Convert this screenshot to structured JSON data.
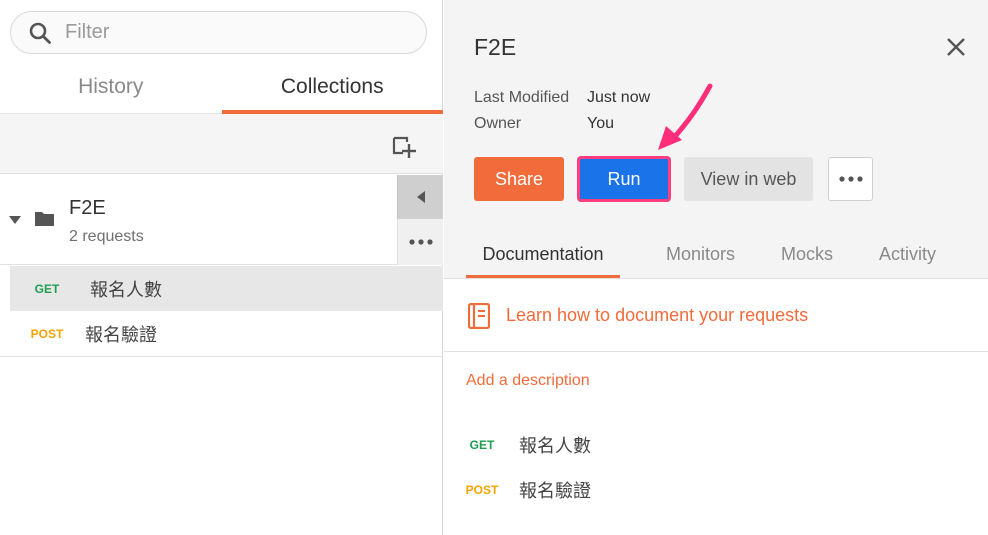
{
  "search": {
    "placeholder": "Filter"
  },
  "sidebar": {
    "tabs": [
      {
        "label": "History",
        "active": false
      },
      {
        "label": "Collections",
        "active": true
      }
    ],
    "collection": {
      "name": "F2E",
      "count": "2 requests",
      "requests": [
        {
          "method": "GET",
          "name": "報名人數"
        },
        {
          "method": "POST",
          "name": "報名驗證"
        }
      ]
    }
  },
  "panel": {
    "title": "F2E",
    "meta": [
      {
        "label": "Last Modified",
        "value": "Just now"
      },
      {
        "label": "Owner",
        "value": "You"
      }
    ],
    "buttons": {
      "share": "Share",
      "run": "Run",
      "view_web": "View in web"
    },
    "tabs": [
      {
        "label": "Documentation",
        "active": true
      },
      {
        "label": "Monitors",
        "active": false
      },
      {
        "label": "Mocks",
        "active": false
      },
      {
        "label": "Activity",
        "active": false
      }
    ],
    "learn_link": "Learn how to document your requests",
    "add_description": "Add a description",
    "requests": [
      {
        "method": "GET",
        "name": "報名人數"
      },
      {
        "method": "POST",
        "name": "報名驗證"
      }
    ]
  },
  "colors": {
    "accent": "#f26b3a",
    "run_button": "#1a73e8",
    "highlight": "#ff3d7f",
    "get": "#1f9e52",
    "post": "#f5a300"
  }
}
